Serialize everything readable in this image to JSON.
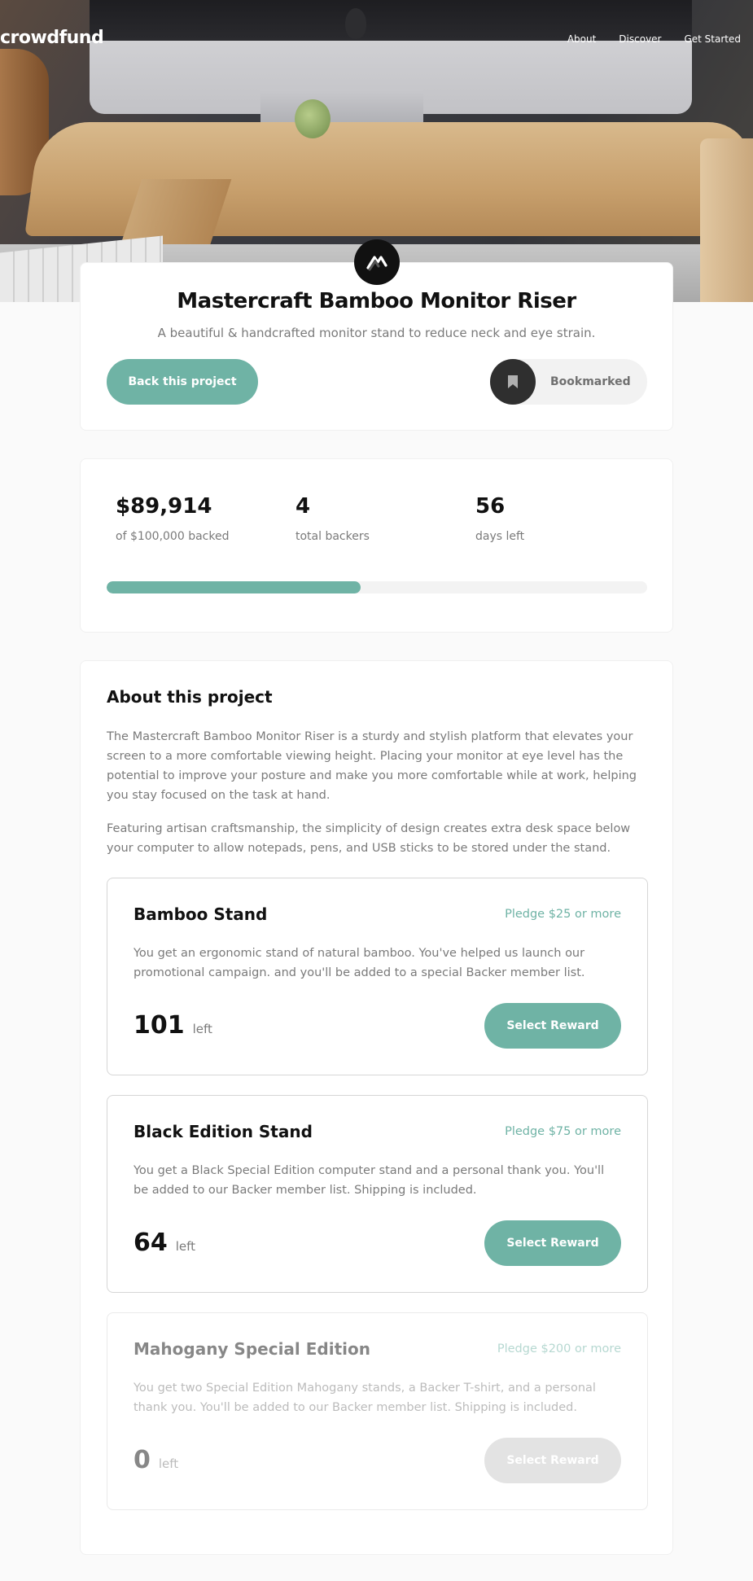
{
  "nav": {
    "logo": "crowdfund",
    "links": [
      "About",
      "Discover",
      "Get Started"
    ]
  },
  "project": {
    "title": "Mastercraft Bamboo Monitor Riser",
    "subtitle": "A beautiful & handcrafted monitor stand to reduce neck and eye strain.",
    "back_button": "Back this project",
    "bookmark_label": "Bookmarked"
  },
  "stats": {
    "backed_amount": "$89,914",
    "backed_label": "of $100,000 backed",
    "backers": "4",
    "backers_label": "total backers",
    "days": "56",
    "days_label": "days left",
    "progress_fraction": 0.47
  },
  "about": {
    "title": "About this project",
    "paragraphs": [
      "The Mastercraft Bamboo Monitor Riser is a sturdy and stylish platform that elevates your screen to a more comfortable viewing height. Placing your monitor at eye level has the potential to improve your posture and make you more comfortable while at work, helping you stay focused on the task at hand.",
      "Featuring artisan craftsmanship, the simplicity of design creates extra desk space below your computer to allow notepads, pens, and USB sticks to be stored under the stand."
    ]
  },
  "rewards": [
    {
      "name": "Bamboo Stand",
      "pledge": "Pledge $25 or more",
      "description": "You get an ergonomic stand of natural bamboo. You've helped us launch our promotional campaign. and you'll be added to a special Backer member list.",
      "count": "101",
      "left_label": "left",
      "button": "Select Reward"
    },
    {
      "name": "Black Edition Stand",
      "pledge": "Pledge $75 or more",
      "description": "You get a Black Special Edition computer stand and a personal thank you. You'll be added to our Backer member list. Shipping is included.",
      "count": "64",
      "left_label": "left",
      "button": "Select Reward"
    },
    {
      "name": "Mahogany Special Edition",
      "pledge": "Pledge $200 or more",
      "description": "You get two Special Edition Mahogany stands, a Backer T-shirt, and a personal thank you. You'll be added to our Backer member list. Shipping is included.",
      "count": "0",
      "left_label": "left",
      "button": "Select Reward"
    }
  ],
  "colors": {
    "accent": "#6fb3a5",
    "dark": "#111111",
    "text_muted": "#7a7a7a"
  },
  "icons": {
    "brand": "mastercraft-logo-icon",
    "bookmark": "bookmark-icon"
  }
}
